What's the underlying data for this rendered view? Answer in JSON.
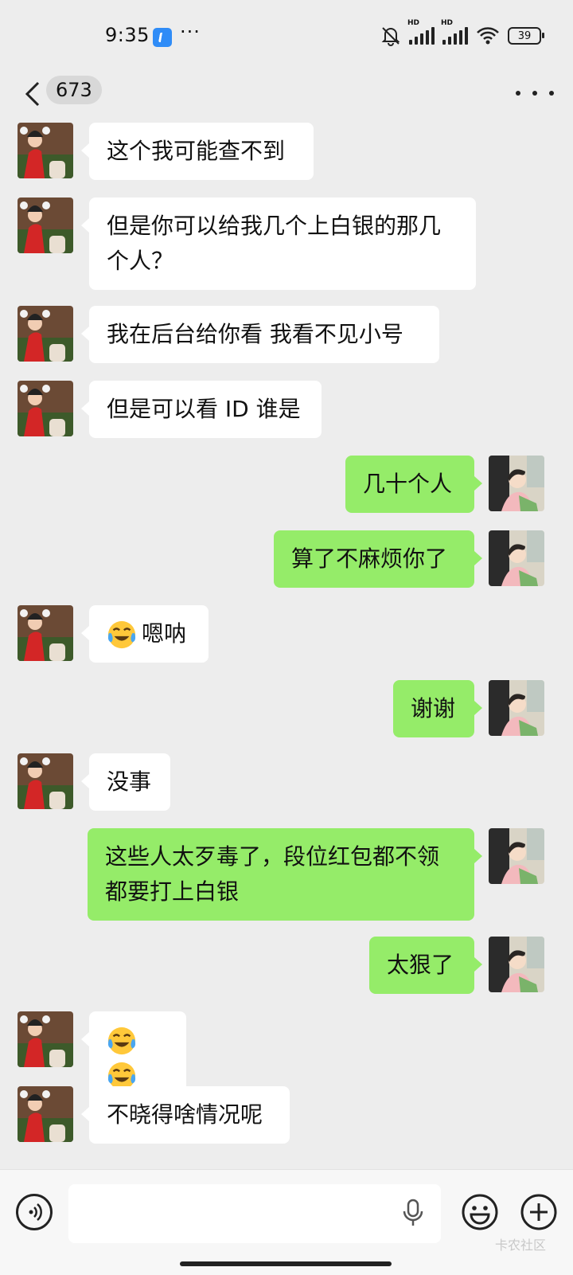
{
  "status_bar": {
    "time": "9:35",
    "more": "···",
    "battery": "39"
  },
  "nav": {
    "unread_count": "673"
  },
  "messages": [
    {
      "side": "left",
      "text": "这个我可能查不到"
    },
    {
      "side": "left",
      "text": "但是你可以给我几个上白银的那几个人？"
    },
    {
      "side": "left",
      "text": "我在后台给你看  我看不见小号"
    },
    {
      "side": "left",
      "text": "但是可以看 ID 谁是"
    },
    {
      "side": "right",
      "text": "几十个人"
    },
    {
      "side": "right",
      "text": "算了不麻烦你了"
    },
    {
      "side": "left",
      "text": "嗯呐",
      "emoji": "crying-laughing-emoji"
    },
    {
      "side": "right",
      "text": "谢谢"
    },
    {
      "side": "left",
      "text": "没事"
    },
    {
      "side": "right",
      "text": "这些人太歹毒了，段位红包都不领都要打上白银"
    },
    {
      "side": "right",
      "text": "太狠了"
    },
    {
      "side": "left",
      "text": "",
      "emoji": "crying-laughing-emoji-x2"
    },
    {
      "side": "left",
      "text": "不晓得啥情况呢"
    }
  ],
  "input": {
    "placeholder": ""
  },
  "icons": {
    "back": "chevron-left-icon",
    "more": "more-dots-icon",
    "voice": "voice-icon",
    "mic": "mic-icon",
    "emoji": "smiley-icon",
    "plus": "plus-icon"
  },
  "colors": {
    "background": "#ededed",
    "bubble_sent": "#95ec69",
    "bubble_received": "#ffffff"
  },
  "watermark": "卡农社区"
}
